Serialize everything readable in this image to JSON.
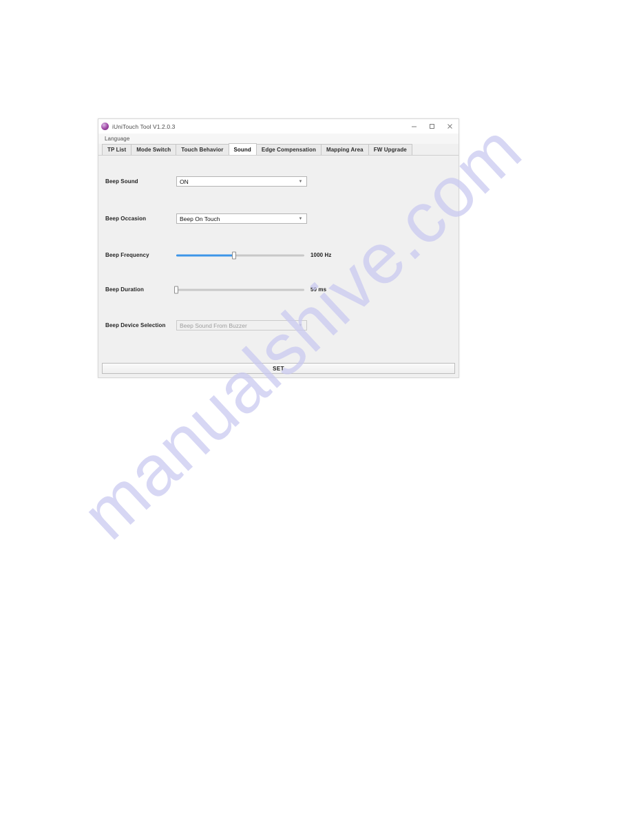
{
  "window": {
    "title": "iUniTouch Tool V1.2.0.3",
    "icon": "app-circle-icon",
    "controls": {
      "minimize": "minimize-icon",
      "maximize": "maximize-restore-icon",
      "close": "close-icon"
    }
  },
  "menubar": {
    "items": [
      {
        "label": "Language"
      }
    ]
  },
  "tabs": [
    {
      "label": "TP List",
      "active": false
    },
    {
      "label": "Mode Switch",
      "active": false
    },
    {
      "label": "Touch Behavior",
      "active": false
    },
    {
      "label": "Sound",
      "active": true
    },
    {
      "label": "Edge Compensation",
      "active": false
    },
    {
      "label": "Mapping Area",
      "active": false
    },
    {
      "label": "FW Upgrade",
      "active": false
    }
  ],
  "sound_panel": {
    "beep_sound": {
      "label": "Beep Sound",
      "value": "ON",
      "arrow": "chevron-down-icon",
      "disabled": false
    },
    "beep_occasion": {
      "label": "Beep Occasion",
      "value": "Beep On Touch",
      "arrow": "chevron-down-icon",
      "disabled": false
    },
    "beep_frequency": {
      "label": "Beep Frequency",
      "value": "1000 Hz",
      "percent": 45
    },
    "beep_duration": {
      "label": "Beep Duration",
      "value": "50 ms",
      "percent": 0
    },
    "beep_device_selection": {
      "label": "Beep Device Selection",
      "value": "Beep Sound From Buzzer",
      "arrow": "chevron-down-icon",
      "disabled": true
    }
  },
  "footer": {
    "set_label": "SET"
  },
  "watermark": {
    "text": "manualshive.com",
    "color": "#c9c9f0"
  }
}
